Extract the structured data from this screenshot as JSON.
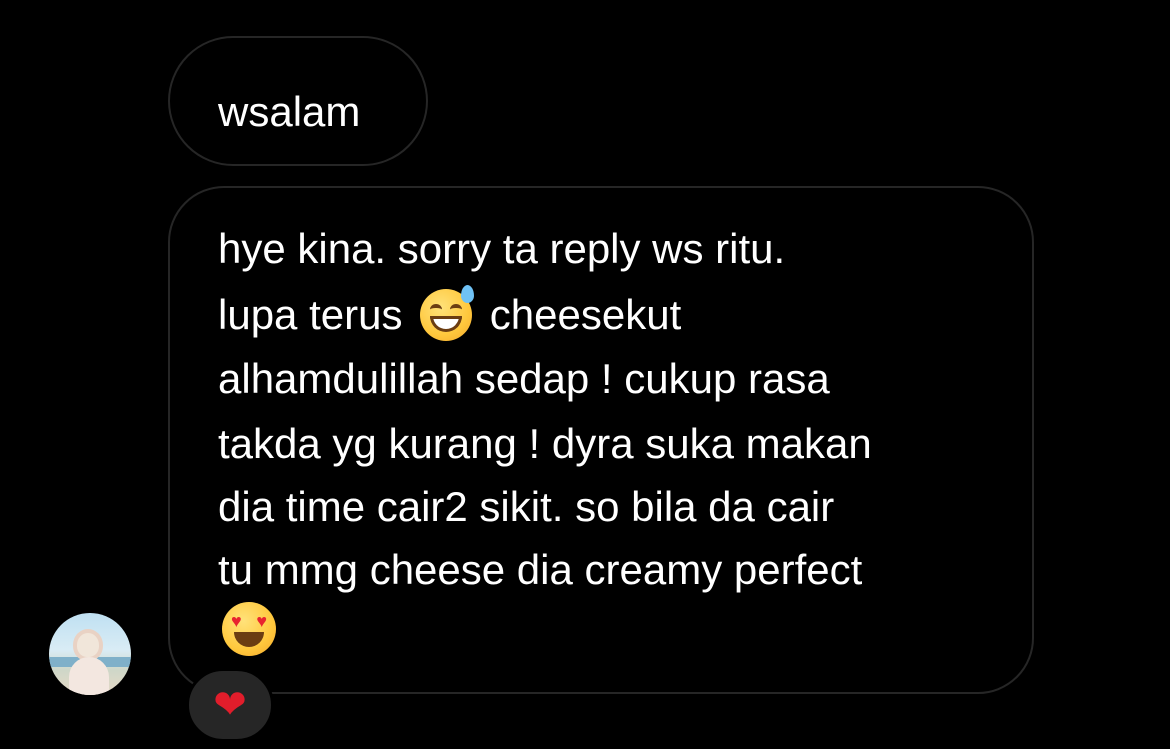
{
  "thread": {
    "messages": [
      {
        "text": "wsalam"
      },
      {
        "lines": [
          "hye kina. sorry ta reply ws ritu.",
          "lupa terus",
          "cheesekut",
          "alhamdulillah sedap ! cukup rasa",
          "takda yg kurang ! dyra suka makan",
          "dia time cair2 sikit. so bila da cair",
          "tu mmg cheese dia creamy perfect"
        ],
        "emojis": [
          "grinning-face-with-sweat-emoji",
          "smiling-face-with-heart-eyes-emoji"
        ],
        "reaction": {
          "glyph": "❤",
          "icon": "red-heart-icon",
          "color": "#e11d2b"
        }
      }
    ]
  },
  "colors": {
    "background": "#000000",
    "bubble_border": "#262626",
    "text": "#ffffff",
    "reaction_background": "#262626"
  }
}
